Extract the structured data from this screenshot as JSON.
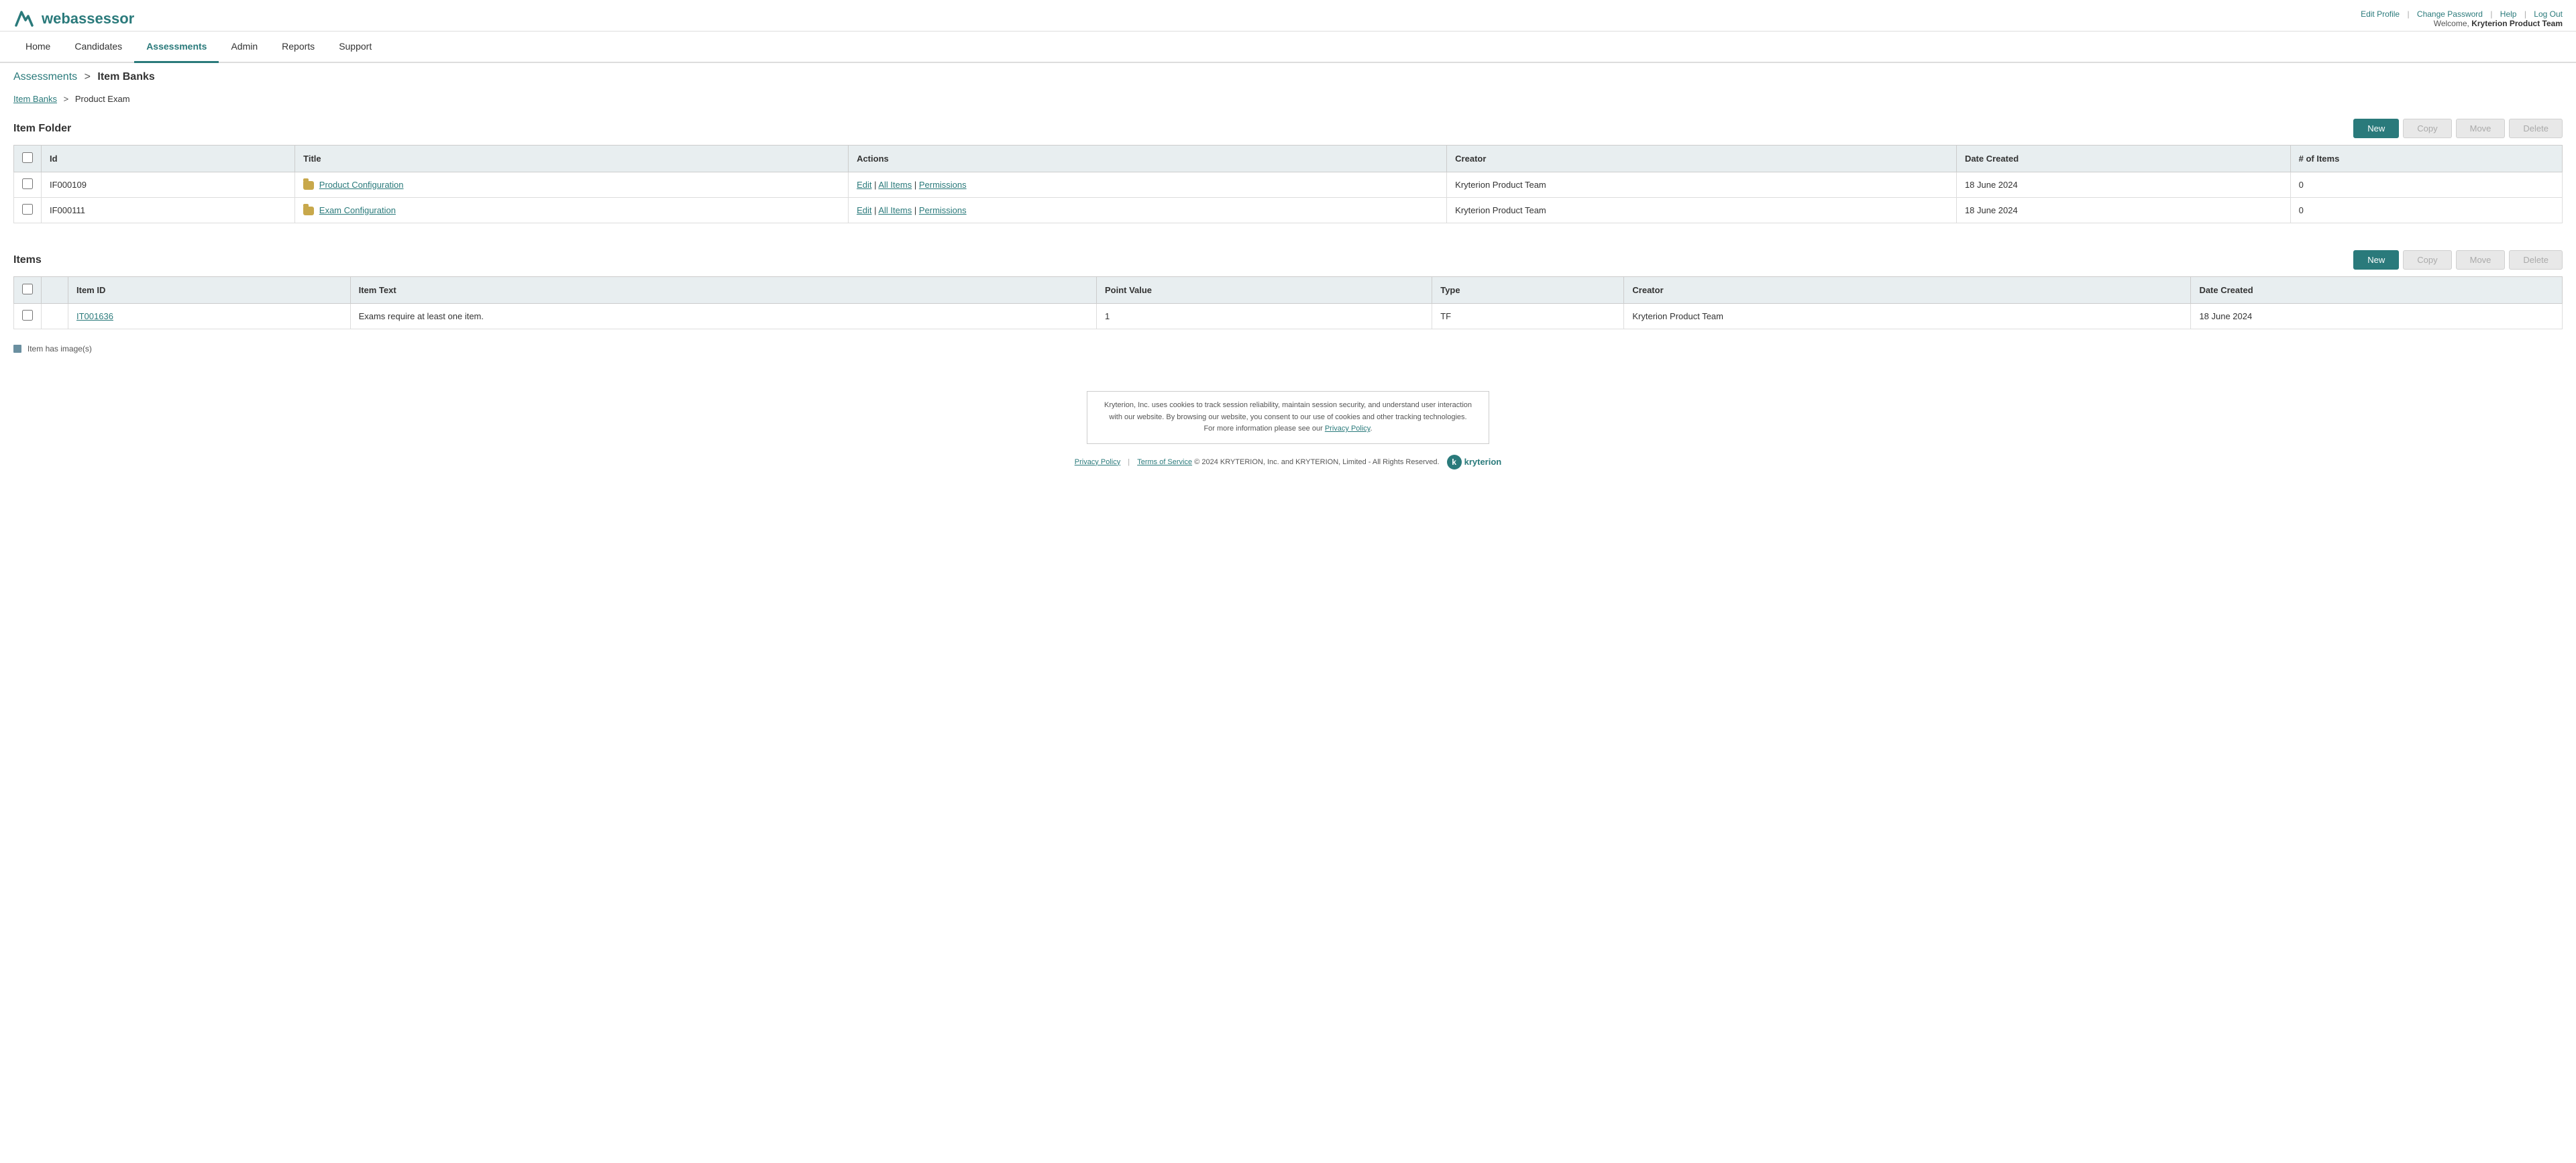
{
  "app": {
    "name": "webassessor",
    "logo_symbol": "W"
  },
  "top_right": {
    "edit_profile": "Edit Profile",
    "change_password": "Change Password",
    "help": "Help",
    "log_out": "Log Out",
    "welcome_label": "Welcome,",
    "welcome_user": "Kryterion Product Team"
  },
  "nav": {
    "items": [
      {
        "label": "Home",
        "active": false
      },
      {
        "label": "Candidates",
        "active": false
      },
      {
        "label": "Assessments",
        "active": true
      },
      {
        "label": "Admin",
        "active": false
      },
      {
        "label": "Reports",
        "active": false
      },
      {
        "label": "Support",
        "active": false
      }
    ]
  },
  "breadcrumb": {
    "parent": "Assessments",
    "separator": ">",
    "current": "Item Banks"
  },
  "sub_breadcrumb": {
    "link": "Item Banks",
    "separator": ">",
    "current": "Product Exam"
  },
  "item_folder_section": {
    "title": "Item Folder",
    "buttons": {
      "new": "New",
      "copy": "Copy",
      "move": "Move",
      "delete": "Delete"
    },
    "table": {
      "columns": [
        "Id",
        "Title",
        "Actions",
        "Creator",
        "Date Created",
        "# of Items"
      ],
      "rows": [
        {
          "id": "IF000109",
          "title": "Product Configuration",
          "actions": [
            "Edit",
            "All Items",
            "Permissions"
          ],
          "creator": "Kryterion Product Team",
          "date_created": "18 June 2024",
          "num_items": "0"
        },
        {
          "id": "IF000111",
          "title": "Exam Configuration",
          "actions": [
            "Edit",
            "All Items",
            "Permissions"
          ],
          "creator": "Kryterion Product Team",
          "date_created": "18 June 2024",
          "num_items": "0"
        }
      ]
    }
  },
  "items_section": {
    "title": "Items",
    "buttons": {
      "new": "New",
      "copy": "Copy",
      "move": "Move",
      "delete": "Delete"
    },
    "table": {
      "columns": [
        "",
        "Item ID",
        "Item Text",
        "Point Value",
        "Type",
        "Creator",
        "Date Created"
      ],
      "rows": [
        {
          "item_id": "IT001636",
          "item_text": "Exams require at least one item.",
          "point_value": "1",
          "type": "TF",
          "creator": "Kryterion Product Team",
          "date_created": "18 June 2024"
        }
      ]
    },
    "legend": "Item has image(s)"
  },
  "footer": {
    "cookie_text": "Kryterion, Inc. uses cookies to track session reliability, maintain session security, and understand user interaction with our website. By browsing our website, you consent to our use of cookies and other tracking technologies. For more information please see our",
    "privacy_policy_link": "Privacy Policy",
    "privacy_policy_end": ".",
    "links": {
      "privacy_policy": "Privacy Policy",
      "terms_of_service": "Terms of Service",
      "copyright": "© 2024  KRYTERION, Inc. and KRYTERION, Limited - All Rights Reserved."
    },
    "kryterion_brand": "kryterion"
  }
}
